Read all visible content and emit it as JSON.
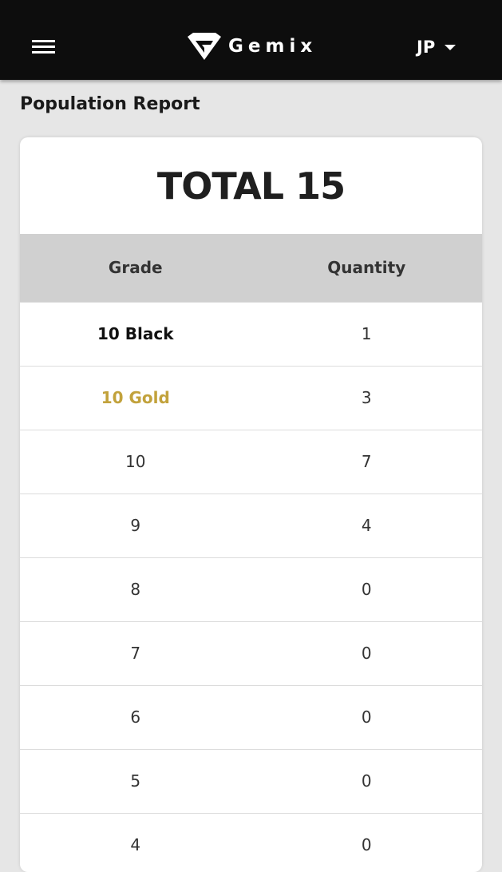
{
  "header": {
    "brand_name": "Gemix",
    "language": "JP",
    "icons": {
      "menu": "hamburger-menu-icon",
      "logo": "gemix-logo-icon",
      "dropdown": "caret-down-icon"
    }
  },
  "page": {
    "title": "Population Report"
  },
  "report": {
    "total_text": "TOTAL 15",
    "columns": {
      "grade": "Grade",
      "quantity": "Quantity"
    },
    "rows": [
      {
        "grade": "10 Black",
        "quantity": "1"
      },
      {
        "grade": "10 Gold",
        "quantity": "3"
      },
      {
        "grade": "10",
        "quantity": "7"
      },
      {
        "grade": "9",
        "quantity": "4"
      },
      {
        "grade": "8",
        "quantity": "0"
      },
      {
        "grade": "7",
        "quantity": "0"
      },
      {
        "grade": "6",
        "quantity": "0"
      },
      {
        "grade": "5",
        "quantity": "0"
      },
      {
        "grade": "4",
        "quantity": "0"
      }
    ]
  },
  "colors": {
    "topbar": "#0d0d0d",
    "background": "#e6e6e6",
    "table_header": "#d0d0d0",
    "gold_grade": "#c2a23c",
    "black_grade": "#111111"
  }
}
